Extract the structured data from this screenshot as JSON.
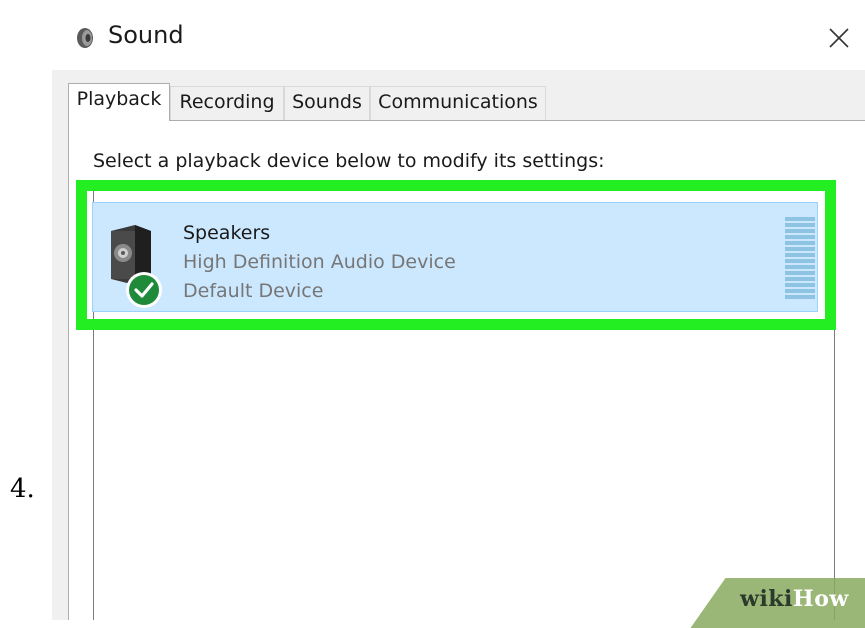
{
  "step": {
    "number": "4."
  },
  "window": {
    "title": "Sound",
    "title_icon": "speaker-icon",
    "close_icon": "close-icon"
  },
  "tabs": [
    {
      "label": "Playback",
      "active": true
    },
    {
      "label": "Recording",
      "active": false
    },
    {
      "label": "Sounds",
      "active": false
    },
    {
      "label": "Communications",
      "active": false
    }
  ],
  "playback": {
    "instruction": "Select a playback device below to modify its settings:",
    "devices": [
      {
        "name": "Speakers",
        "description": "High Definition Audio Device",
        "status": "Default Device",
        "icon": "speaker-device-icon",
        "badge_icon": "checkmark-icon",
        "selected": true
      }
    ]
  },
  "colors": {
    "highlight": "#22ee22",
    "selection": "#cce8ff",
    "default_badge": "#1e8a3a"
  },
  "watermark": {
    "part1": "wiki",
    "part2": "How"
  }
}
